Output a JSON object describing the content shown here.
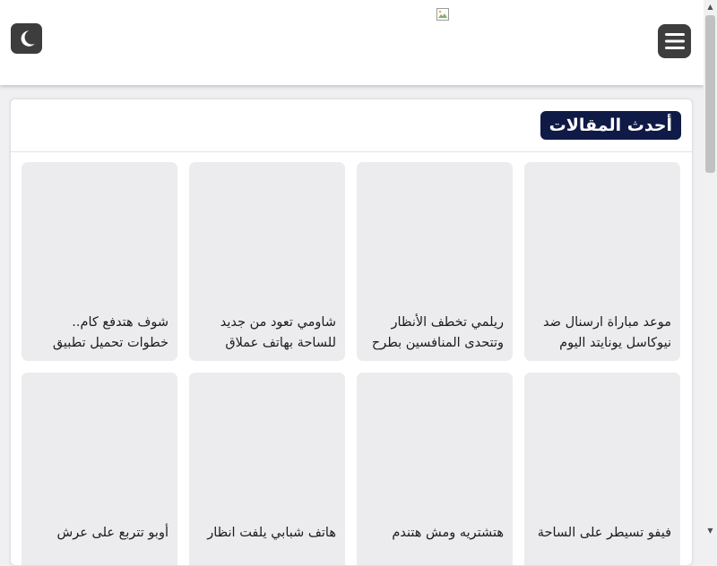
{
  "header": {
    "dark_mode_icon": "moon-icon",
    "menu_icon": "hamburger-menu-icon",
    "logo_icon": "broken-image-icon"
  },
  "latest": {
    "title": "أحدث المقالات",
    "articles": [
      {
        "title_line1": "موعد مباراة ارسنال ضد",
        "title_line2": "نيوكاسل يونايتد اليوم"
      },
      {
        "title_line1": "ريلمي تخطف الأنظار",
        "title_line2": "وتتحدى المنافسين بطرح"
      },
      {
        "title_line1": "شاومي تعود من جديد",
        "title_line2": "للساحة بهاتف عملاق"
      },
      {
        "title_line1": "شوف هتدفع كام..",
        "title_line2": "خطوات تحميل تطبيق"
      },
      {
        "title_line1": "فيفو تسيطر على الساحة",
        "title_line2": ""
      },
      {
        "title_line1": "هتشتريه ومش هتندم",
        "title_line2": ""
      },
      {
        "title_line1": "هاتف شبابي يلفت انظار",
        "title_line2": ""
      },
      {
        "title_line1": "أوبو تتربع على عرش",
        "title_line2": ""
      }
    ]
  },
  "scrollbar": {
    "up_icon": "scroll-up-arrow-icon",
    "down_icon": "scroll-down-arrow-icon"
  }
}
